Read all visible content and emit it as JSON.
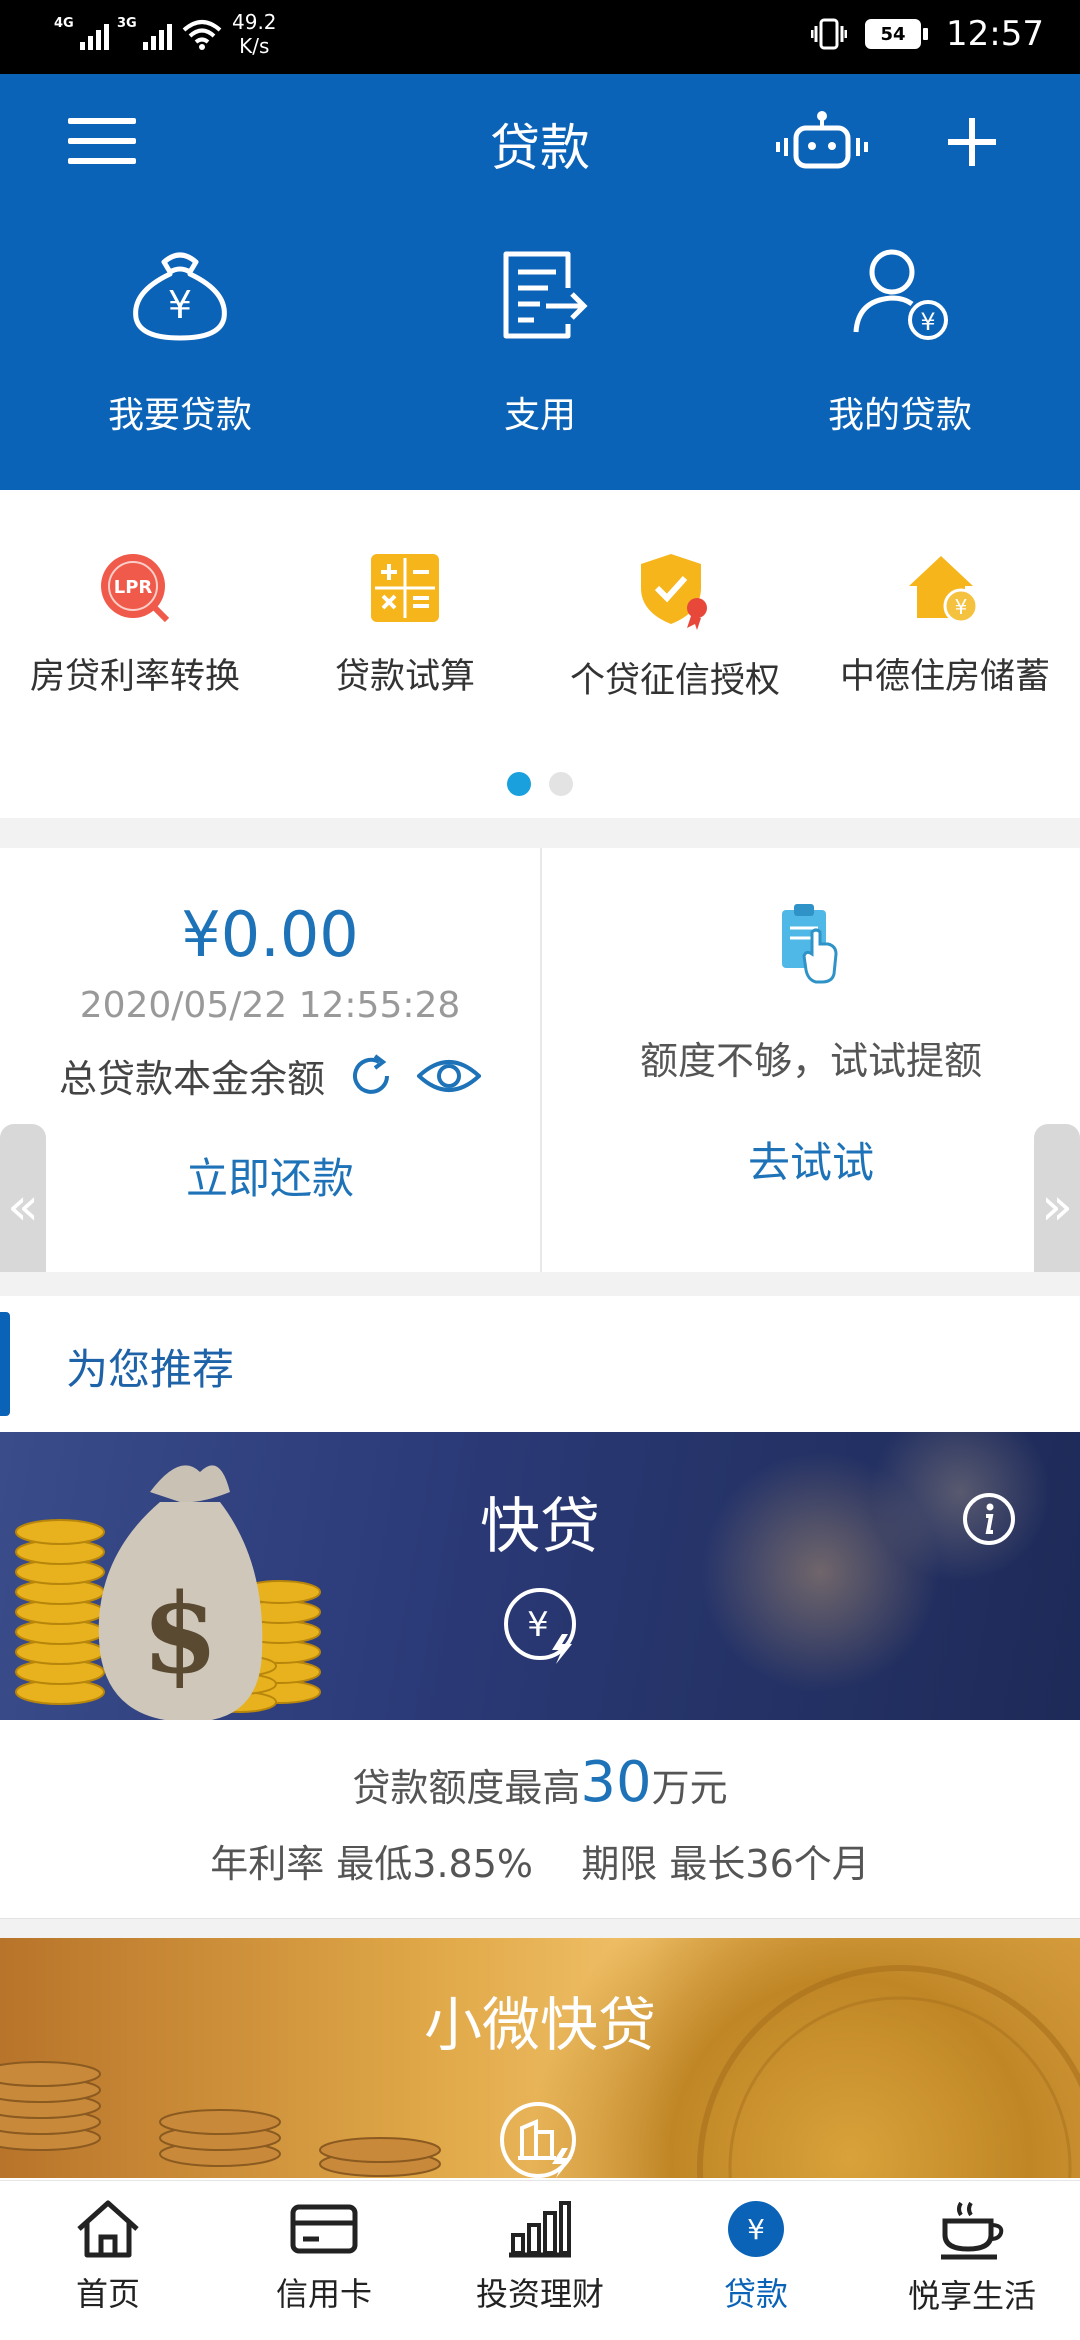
{
  "status_bar": {
    "network_tags": [
      "4G",
      "3G"
    ],
    "net_speed_value": "49.2",
    "net_speed_unit": "K/s",
    "battery": "54",
    "time": "12:57"
  },
  "header": {
    "title": "贷款",
    "actions": [
      {
        "label": "我要贷款",
        "icon": "money-bag-icon"
      },
      {
        "label": "支用",
        "icon": "document-arrow-icon"
      },
      {
        "label": "我的贷款",
        "icon": "user-yuan-icon"
      }
    ]
  },
  "tools": {
    "items": [
      {
        "label": "房贷利率转换",
        "icon": "lpr-icon"
      },
      {
        "label": "贷款试算",
        "icon": "calculator-icon"
      },
      {
        "label": "个贷征信授权",
        "icon": "shield-badge-icon"
      },
      {
        "label": "中德住房储蓄",
        "icon": "house-yuan-icon"
      }
    ],
    "lpr_text": "LPR",
    "page_count": 2,
    "active_page": 1
  },
  "summary": {
    "amount": "¥0.00",
    "timestamp": "2020/05/22 12:55:28",
    "balance_label": "总贷款本金余额",
    "repay_label": "立即还款",
    "raise_text": "额度不够，试试提额",
    "try_label": "去试试"
  },
  "recommend": {
    "title": "为您推荐",
    "products": [
      {
        "title": "快贷",
        "desc_prefix": "贷款额度最高",
        "desc_amount": "30",
        "desc_suffix": "万元",
        "rate_line": "年利率 最低3.85%    期限 最长36个月"
      },
      {
        "title": "小微快贷"
      }
    ]
  },
  "tabbar": {
    "tabs": [
      {
        "label": "首页",
        "icon": "home-icon"
      },
      {
        "label": "信用卡",
        "icon": "credit-card-icon"
      },
      {
        "label": "投资理财",
        "icon": "bar-chart-icon"
      },
      {
        "label": "贷款",
        "icon": "loan-yuan-icon"
      },
      {
        "label": "悦享生活",
        "icon": "coffee-cup-icon"
      }
    ],
    "active": 3
  },
  "colors": {
    "brand_blue": "#0b63b8",
    "link_blue": "#1e73b8",
    "dot_active": "#1aa0dc"
  }
}
